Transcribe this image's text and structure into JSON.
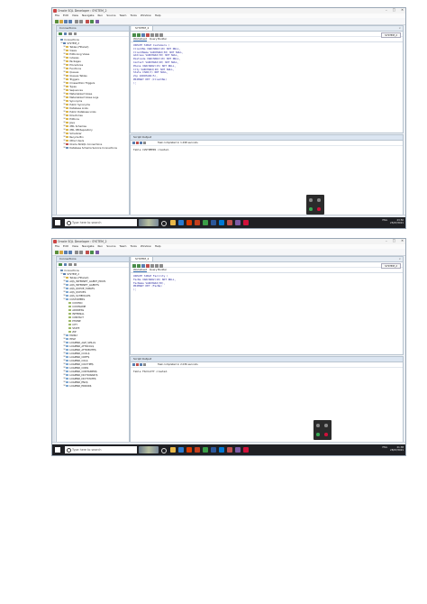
{
  "shot1": {
    "title": "Oracle SQL Developer : SYSTEM_2",
    "menu": [
      "File",
      "Edit",
      "View",
      "Navigate",
      "Run",
      "Source",
      "Team",
      "Tools",
      "Window",
      "Help"
    ],
    "connections_header": "Connections",
    "tree": [
      {
        "label": "Connections",
        "expand": "",
        "icon": "#6b8fb5"
      },
      {
        "label": "SYSTEM_2",
        "expand": "⊟",
        "icon": "#5a7fb0"
      },
      {
        "label": "Tables (Filtered)",
        "expand": "⊞",
        "icon": "#d9b44a"
      },
      {
        "label": "Views",
        "expand": "⊞",
        "icon": "#d9b44a"
      },
      {
        "label": "Editioning Views",
        "expand": "⊞",
        "icon": "#d9b44a"
      },
      {
        "label": "Indexes",
        "expand": "⊞",
        "icon": "#d9b44a"
      },
      {
        "label": "Packages",
        "expand": "⊞",
        "icon": "#d9b44a"
      },
      {
        "label": "Procedures",
        "expand": "⊞",
        "icon": "#d9b44a"
      },
      {
        "label": "Functions",
        "expand": "⊞",
        "icon": "#d9b44a"
      },
      {
        "label": "Queues",
        "expand": "⊞",
        "icon": "#d9b44a"
      },
      {
        "label": "Queues Tables",
        "expand": "⊞",
        "icon": "#d9b44a"
      },
      {
        "label": "Triggers",
        "expand": "⊞",
        "icon": "#d9b44a"
      },
      {
        "label": "Crossedition Triggers",
        "expand": "⊞",
        "icon": "#d9b44a"
      },
      {
        "label": "Types",
        "expand": "⊞",
        "icon": "#d9b44a"
      },
      {
        "label": "Sequences",
        "expand": "⊞",
        "icon": "#d9b44a"
      },
      {
        "label": "Materialized Views",
        "expand": "⊞",
        "icon": "#d9b44a"
      },
      {
        "label": "Materialized Views Logs",
        "expand": "⊞",
        "icon": "#d9b44a"
      },
      {
        "label": "Synonyms",
        "expand": "⊞",
        "icon": "#d9b44a"
      },
      {
        "label": "Public Synonyms",
        "expand": "⊞",
        "icon": "#d9b44a"
      },
      {
        "label": "Database Links",
        "expand": "⊞",
        "icon": "#d9b44a"
      },
      {
        "label": "Public Database Links",
        "expand": "⊞",
        "icon": "#d9b44a"
      },
      {
        "label": "Directories",
        "expand": "⊞",
        "icon": "#d9b44a"
      },
      {
        "label": "Editions",
        "expand": "⊞",
        "icon": "#d9b44a"
      },
      {
        "label": "Java",
        "expand": "⊞",
        "icon": "#d9b44a"
      },
      {
        "label": "XML Schemas",
        "expand": "⊞",
        "icon": "#d9b44a"
      },
      {
        "label": "XML DB Repository",
        "expand": "⊞",
        "icon": "#d9b44a"
      },
      {
        "label": "Scheduler",
        "expand": "⊞",
        "icon": "#d9b44a"
      },
      {
        "label": "Recycle Bin",
        "expand": "⊞",
        "icon": "#d9b44a"
      },
      {
        "label": "Other Users",
        "expand": "⊞",
        "icon": "#d9b44a"
      },
      {
        "label": "Oracle NoSQL Connections",
        "expand": "⊞",
        "icon": "#c0504d"
      },
      {
        "label": "Database Schema Service Connections",
        "expand": "⊞",
        "icon": "#6b8fb5"
      }
    ],
    "tab_label": "SYSTEM_2",
    "connection_selector": "SYSTEM_2",
    "subtabs": [
      "Worksheet",
      "Query Builder"
    ],
    "code": [
      "CREATE TABLE Customers (",
      "ClientNo VARCHAR2(10) NOT NULL,",
      "ClientName VARCHAR2(30) NOT NULL,",
      "Address VARCHAR2(30) NOT NULL,",
      "Postcode VARCHAR2(10) NOT NULL,",
      "Contact VARCHAR2(20) NOT NULL,",
      "Phone VARCHAR2(15) NOT NULL,",
      "City VARCHAR2(20) NOT NULL,",
      "State CHAR(3) NOT NULL,",
      "Zip VARCHAR2(5),",
      "PRIMARY KEY (ClientNo)",
      ");"
    ],
    "output_header": "Script Output",
    "task_text": "Task completed in 1.298 seconds",
    "output_text": "Table CUSTOMERS created.",
    "search_placeholder": "Type here to search",
    "clock_time": "23:50",
    "clock_date": "25/07/2021",
    "tray_lang": "ENG",
    "status_msg": "Screenshot enabled (Windows + ...)"
  },
  "shot2": {
    "title": "Oracle SQL Developer : SYSTEM_2",
    "menu": [
      "File",
      "Edit",
      "View",
      "Navigate",
      "Run",
      "Source",
      "Team",
      "Tools",
      "Window",
      "Help"
    ],
    "connections_header": "Connections",
    "tree": [
      {
        "label": "Connections",
        "expand": "",
        "icon": "#6b8fb5"
      },
      {
        "label": "SYSTEM_2",
        "expand": "⊟",
        "icon": "#5a7fb0"
      },
      {
        "label": "Tables (Filtered)",
        "expand": "⊟",
        "icon": "#d9b44a"
      },
      {
        "label": "AQ$_INTERNET_AGENT_PRIVS",
        "expand": "⊞",
        "icon": "#7fa7cf"
      },
      {
        "label": "AQ$_INTERNET_AGENTS",
        "expand": "⊞",
        "icon": "#7fa7cf"
      },
      {
        "label": "AQ$_QUEUE_TABLES",
        "expand": "⊞",
        "icon": "#7fa7cf"
      },
      {
        "label": "AQ$_QUEUES",
        "expand": "⊞",
        "icon": "#7fa7cf"
      },
      {
        "label": "AQ$_SCHEDULES",
        "expand": "⊞",
        "icon": "#7fa7cf"
      },
      {
        "label": "CUSTOMERS",
        "expand": "⊟",
        "icon": "#7fa7cf"
      },
      {
        "label": "CUSTNO",
        "expand": "",
        "icon": "#9db86a"
      },
      {
        "label": "CUSTNAME",
        "expand": "",
        "icon": "#9db86a"
      },
      {
        "label": "ADDRESS",
        "expand": "",
        "icon": "#9db86a"
      },
      {
        "label": "INTERNAL",
        "expand": "",
        "icon": "#9db86a"
      },
      {
        "label": "CONTACT",
        "expand": "",
        "icon": "#9db86a"
      },
      {
        "label": "PHONE",
        "expand": "",
        "icon": "#9db86a"
      },
      {
        "label": "CITY",
        "expand": "",
        "icon": "#9db86a"
      },
      {
        "label": "STATE",
        "expand": "",
        "icon": "#9db86a"
      },
      {
        "label": "ZIP",
        "expand": "",
        "icon": "#9db86a"
      },
      {
        "label": "FAMILY",
        "expand": "⊞",
        "icon": "#7fa7cf"
      },
      {
        "label": "HELP",
        "expand": "⊞",
        "icon": "#7fa7cf"
      },
      {
        "label": "LOGMNR_AGE_SPILLS",
        "expand": "⊞",
        "icon": "#7fa7cf"
      },
      {
        "label": "LOGMNR_ATTRCOL$",
        "expand": "⊞",
        "icon": "#7fa7cf"
      },
      {
        "label": "LOGMNR_ATTRIBUTE$",
        "expand": "⊞",
        "icon": "#7fa7cf"
      },
      {
        "label": "LOGMNR_CCOL$",
        "expand": "⊞",
        "icon": "#7fa7cf"
      },
      {
        "label": "LOGMNR_CDEF$",
        "expand": "⊞",
        "icon": "#7fa7cf"
      },
      {
        "label": "LOGMNR_COL$",
        "expand": "⊞",
        "icon": "#7fa7cf"
      },
      {
        "label": "LOGMNR_COLTYPE$",
        "expand": "⊞",
        "icon": "#7fa7cf"
      },
      {
        "label": "LOGMNR_CON$",
        "expand": "⊞",
        "icon": "#7fa7cf"
      },
      {
        "label": "LOGMNR_CONTAINER$",
        "expand": "⊞",
        "icon": "#7fa7cf"
      },
      {
        "label": "LOGMNR_DICTIONARY$",
        "expand": "⊞",
        "icon": "#7fa7cf"
      },
      {
        "label": "LOGMNR_DICTSTATE$",
        "expand": "⊞",
        "icon": "#7fa7cf"
      },
      {
        "label": "LOGMNR_ENC$",
        "expand": "⊞",
        "icon": "#7fa7cf"
      },
      {
        "label": "LOGMNR_ERROR$",
        "expand": "⊞",
        "icon": "#7fa7cf"
      }
    ],
    "tab_label": "SYSTEM_2",
    "connection_selector": "SYSTEM_2",
    "subtabs": [
      "Worksheet",
      "Query Builder"
    ],
    "code": [
      "CREATE TABLE Facility (",
      "FacNo VARCHAR2(10) NOT NULL,",
      "FacName VARCHAR2(30),",
      "PRIMARY KEY (FacNo)",
      ");"
    ],
    "output_header": "Script Output",
    "task_text": "Task completed in 2.036 seconds",
    "output_text": "Table FACILITY created.",
    "search_placeholder": "Type here to search",
    "clock_time": "21:38",
    "clock_date": "28/07/2021",
    "tray_lang": "ENG",
    "status_msg": "Screenshot enabled (Windows + ...)"
  }
}
